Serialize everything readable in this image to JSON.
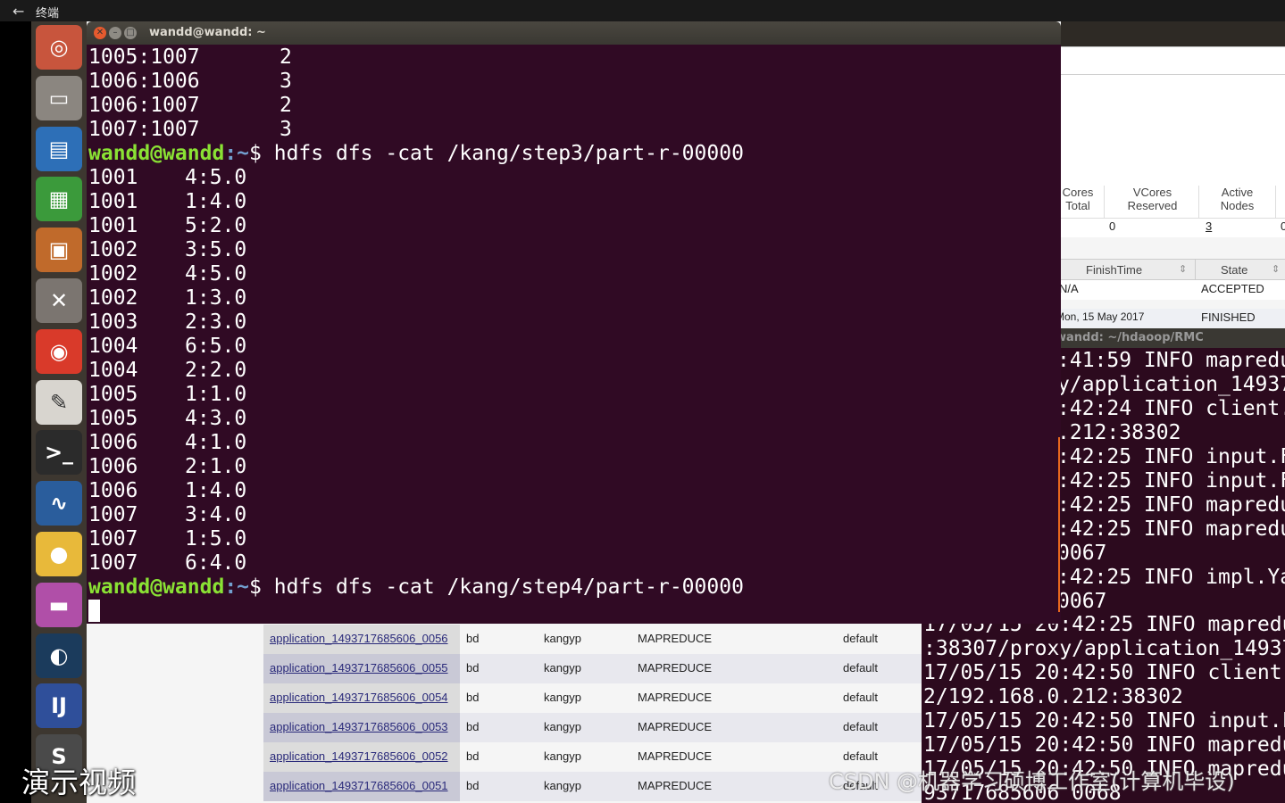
{
  "topbar": {
    "back_glyph": "←",
    "title": "终端"
  },
  "launcher": {
    "items": [
      {
        "name": "ubuntu-icon",
        "glyph": "◎",
        "bg": "#c8553d"
      },
      {
        "name": "files-icon",
        "glyph": "▭",
        "bg": "#8b8680"
      },
      {
        "name": "writer-icon",
        "glyph": "▤",
        "bg": "#2d6fb7"
      },
      {
        "name": "calc-icon",
        "glyph": "▦",
        "bg": "#3b9a3b"
      },
      {
        "name": "impress-icon",
        "glyph": "▣",
        "bg": "#c06a2b"
      },
      {
        "name": "settings-icon",
        "glyph": "✕",
        "bg": "#7b7570"
      },
      {
        "name": "netease-music-icon",
        "glyph": "◉",
        "bg": "#d93a2a"
      },
      {
        "name": "text-editor-icon",
        "glyph": "✎",
        "bg": "#d8d5cf"
      },
      {
        "name": "terminal-icon",
        "glyph": ">_",
        "bg": "#2b2b2b"
      },
      {
        "name": "mysql-workbench-icon",
        "glyph": "∿",
        "bg": "#2a5d9c"
      },
      {
        "name": "hadoop-icon",
        "glyph": "●",
        "bg": "#e8b93a"
      },
      {
        "name": "app-window-icon",
        "glyph": "▬",
        "bg": "#b04fa8"
      },
      {
        "name": "steam-icon",
        "glyph": "◐",
        "bg": "#1b3b5c"
      },
      {
        "name": "intellij-icon",
        "glyph": "IJ",
        "bg": "#2f4f9a"
      },
      {
        "name": "sublime-icon",
        "glyph": "S",
        "bg": "#4a4a4a"
      }
    ]
  },
  "terminal": {
    "title": "wandd@wandd: ~",
    "user": "wandd@wandd",
    "path": ":~",
    "dollar": "$ ",
    "lines_before": [
      {
        "k": "1005:1007",
        "v": "2"
      },
      {
        "k": "1006:1006",
        "v": "3"
      },
      {
        "k": "1006:1007",
        "v": "2"
      },
      {
        "k": "1007:1007",
        "v": "3"
      }
    ],
    "command1": "hdfs dfs -cat /kang/step3/part-r-00000",
    "output": [
      {
        "k": "1001",
        "v": "4:5.0"
      },
      {
        "k": "1001",
        "v": "1:4.0"
      },
      {
        "k": "1001",
        "v": "5:2.0"
      },
      {
        "k": "1002",
        "v": "3:5.0"
      },
      {
        "k": "1002",
        "v": "4:5.0"
      },
      {
        "k": "1002",
        "v": "1:3.0"
      },
      {
        "k": "1003",
        "v": "2:3.0"
      },
      {
        "k": "1004",
        "v": "6:5.0"
      },
      {
        "k": "1004",
        "v": "2:2.0"
      },
      {
        "k": "1005",
        "v": "1:1.0"
      },
      {
        "k": "1005",
        "v": "4:3.0"
      },
      {
        "k": "1006",
        "v": "4:1.0"
      },
      {
        "k": "1006",
        "v": "2:1.0"
      },
      {
        "k": "1006",
        "v": "1:4.0"
      },
      {
        "k": "1007",
        "v": "3:4.0"
      },
      {
        "k": "1007",
        "v": "1:5.0"
      },
      {
        "k": "1007",
        "v": "6:4.0"
      }
    ],
    "command2": "hdfs dfs -cat /kang/step4/part-r-00000"
  },
  "rm_metrics": {
    "h1": "Cores\nTotal",
    "h1a": "Cores",
    "h1b": "Total",
    "h2a": "VCores",
    "h2b": "Reserved",
    "h3a": "Active",
    "h3b": "Nodes",
    "v2": "0",
    "v3": "3",
    "v4": "0"
  },
  "rm_apps": {
    "col_finish": "FinishTime",
    "col_state": "State",
    "rows": [
      {
        "finish": "N/A",
        "state": "ACCEPTED"
      },
      {
        "finish": "Mon, 15 May 2017",
        "state": "FINISHED"
      }
    ]
  },
  "terminal2": {
    "title": "wandd: ~/hdaoop/RMC",
    "lines": [
      ":41:59 INFO mapredu",
      "y/application_14937",
      ":42:24 INFO client.",
      ".212:38302",
      ":42:25 INFO input.F",
      ":42:25 INFO input.F",
      ":42:25 INFO mapredu",
      ":42:25 INFO mapredu",
      "0067",
      ":42:25 INFO impl.Ya",
      "0067"
    ]
  },
  "terminal3": {
    "lines": [
      "17/05/15 20:42:25 INFO mapredu",
      ":38307/proxy/application_14937",
      "17/05/15 20:42:50 INFO client.",
      "2/192.168.0.212:38302",
      "17/05/15 20:42:50 INFO input.F",
      "17/05/15 20:42:50 INFO mapredu",
      "17/05/15 20:42:50 INFO mapredu",
      "93717685606_0068"
    ]
  },
  "app_table": {
    "rows": [
      {
        "id": "application_1493717685606_0056",
        "user": "bd",
        "name": "kangyp",
        "type": "MAPREDUCE",
        "queue": "default"
      },
      {
        "id": "application_1493717685606_0055",
        "user": "bd",
        "name": "kangyp",
        "type": "MAPREDUCE",
        "queue": "default"
      },
      {
        "id": "application_1493717685606_0054",
        "user": "bd",
        "name": "kangyp",
        "type": "MAPREDUCE",
        "queue": "default"
      },
      {
        "id": "application_1493717685606_0053",
        "user": "bd",
        "name": "kangyp",
        "type": "MAPREDUCE",
        "queue": "default"
      },
      {
        "id": "application_1493717685606_0052",
        "user": "bd",
        "name": "kangyp",
        "type": "MAPREDUCE",
        "queue": "default"
      },
      {
        "id": "application_1493717685606_0051",
        "user": "bd",
        "name": "kangyp",
        "type": "MAPREDUCE",
        "queue": "default"
      }
    ]
  },
  "overlay": {
    "caption": "演示视频",
    "watermark": "CSDN @机器学习硕博工作室(计算机毕设)"
  }
}
